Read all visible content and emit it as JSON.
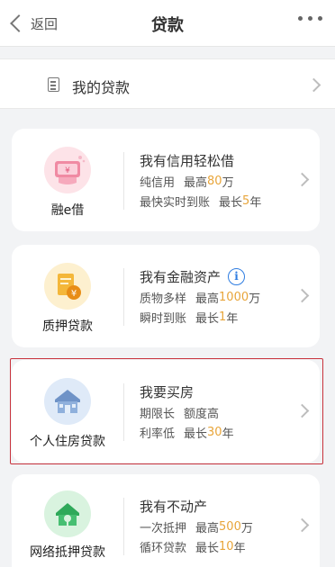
{
  "nav": {
    "back_label": "返回",
    "title": "贷款"
  },
  "my_loans": {
    "label": "我的贷款"
  },
  "products": [
    {
      "name": "融e借",
      "headline": "我有信用轻松借",
      "line1": {
        "a": "纯信用",
        "b_prefix": "最高",
        "b_value": "80",
        "b_suffix": "万"
      },
      "line2": {
        "a": "最快实时到账",
        "b_prefix": "最长",
        "b_value": "5",
        "b_suffix": "年"
      }
    },
    {
      "name": "质押贷款",
      "headline": "我有金融资产",
      "line1": {
        "a": "质物多样",
        "b_prefix": "最高",
        "b_value": "1000",
        "b_suffix": "万"
      },
      "line2": {
        "a": "瞬时到账",
        "b_prefix": "最长",
        "b_value": "1",
        "b_suffix": "年"
      }
    },
    {
      "name": "个人住房贷款",
      "headline": "我要买房",
      "line1": {
        "a": "期限长",
        "b_prefix": "额度高",
        "b_value": "",
        "b_suffix": ""
      },
      "line2": {
        "a": "利率低",
        "b_prefix": "最长",
        "b_value": "30",
        "b_suffix": "年"
      }
    },
    {
      "name": "网络抵押贷款",
      "headline": "我有不动产",
      "line1": {
        "a": "一次抵押",
        "b_prefix": "最高",
        "b_value": "500",
        "b_suffix": "万"
      },
      "line2": {
        "a": "循环贷款",
        "b_prefix": "最长",
        "b_value": "10",
        "b_suffix": "年"
      }
    }
  ],
  "icons": {
    "back": "chevron-left-icon",
    "more": "more-dots-icon",
    "my_loans": "document-icon",
    "info": "info-icon",
    "row_arrow": "chevron-right-icon"
  },
  "colors": {
    "highlight": "#e8a53a",
    "selection_border": "#c8323c",
    "info_blue": "#2f7de1"
  }
}
